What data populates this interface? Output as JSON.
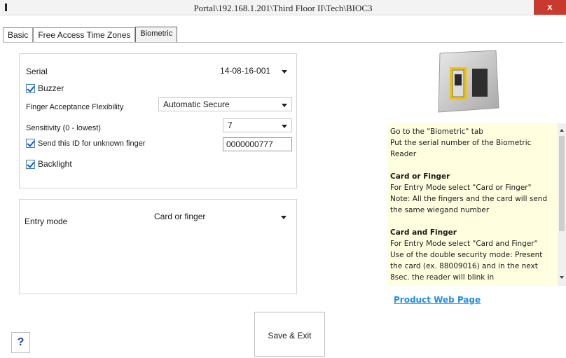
{
  "window": {
    "title": "Portal\\192.168.1.201\\Third Floor II\\Tech\\BIOC3",
    "close_label": "x"
  },
  "tabs": [
    {
      "label": "Basic"
    },
    {
      "label": "Free Access Time Zones"
    },
    {
      "label": "Biometric",
      "active": true
    }
  ],
  "settings": {
    "serial_label": "Serial",
    "serial_value": "14-08-16-001",
    "buzzer_label": "Buzzer",
    "buzzer_checked": true,
    "flex_label": "Finger Acceptance Flexibility",
    "flex_value": "Automatic Secure",
    "sensitivity_label": "Sensitivity (0 - lowest)",
    "sensitivity_value": "7",
    "unknown_id_label": "Send this ID for unknown finger",
    "unknown_id_checked": true,
    "unknown_id_value": "0000000777",
    "backlight_label": "Backlight",
    "backlight_checked": true
  },
  "entry": {
    "label": "Entry mode",
    "value": "Card or finger"
  },
  "help": {
    "intro_1": "Go to the \"Biometric\" tab",
    "intro_2": "Put the serial number of the Biometric Reader",
    "s1_title": "Card or Finger",
    "s1_line1": "For Entry Mode select \"Card or Finger\"",
    "s1_line2": "Note: All the fingers and the card will send the same wiegand number",
    "s2_title": "Card and Finger",
    "s2_line1": "For Entry Mode select \"Card and Finger\"",
    "s2_line2": "Use of the double security mode: Present the card (ex. 88009016) and in the next 8sec. the reader will blink in"
  },
  "product_link": "Product Web Page",
  "save_label": "Save & Exit",
  "help_button": "?",
  "colors": {
    "close": "#c8392e",
    "help_panel": "#ffffe0",
    "link": "#1e90e8",
    "device_frame": "#f2c200"
  }
}
